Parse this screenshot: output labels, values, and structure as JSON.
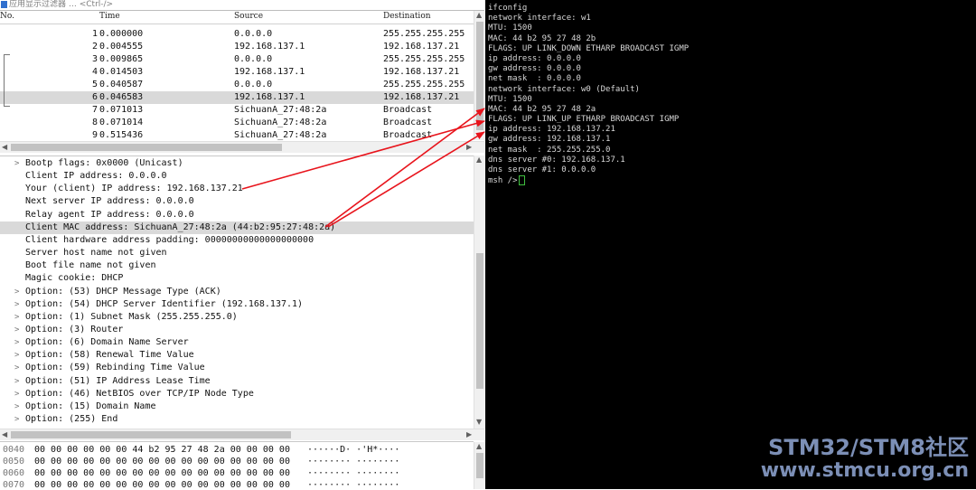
{
  "filter_bar": {
    "placeholder": "应用显示过滤器 … <Ctrl-/>"
  },
  "packet_list": {
    "columns": [
      "No.",
      "Time",
      "Source",
      "Destination"
    ],
    "rows": [
      {
        "no": "1",
        "time": "0.000000",
        "source": "0.0.0.0",
        "destination": "255.255.255.255"
      },
      {
        "no": "2",
        "time": "0.004555",
        "source": "192.168.137.1",
        "destination": "192.168.137.21"
      },
      {
        "no": "3",
        "time": "0.009865",
        "source": "0.0.0.0",
        "destination": "255.255.255.255"
      },
      {
        "no": "4",
        "time": "0.014503",
        "source": "192.168.137.1",
        "destination": "192.168.137.21"
      },
      {
        "no": "5",
        "time": "0.040587",
        "source": "0.0.0.0",
        "destination": "255.255.255.255"
      },
      {
        "no": "6",
        "time": "0.046583",
        "source": "192.168.137.1",
        "destination": "192.168.137.21",
        "selected": true
      },
      {
        "no": "7",
        "time": "0.071013",
        "source": "SichuanA_27:48:2a",
        "destination": "Broadcast"
      },
      {
        "no": "8",
        "time": "0.071014",
        "source": "SichuanA_27:48:2a",
        "destination": "Broadcast"
      },
      {
        "no": "9",
        "time": "0.515436",
        "source": "SichuanA_27:48:2a",
        "destination": "Broadcast"
      }
    ]
  },
  "details": [
    {
      "text": "Bootp flags: 0x0000 (Unicast)",
      "expandable": true
    },
    {
      "text": "Client IP address: 0.0.0.0"
    },
    {
      "text": "Your (client) IP address: 192.168.137.21"
    },
    {
      "text": "Next server IP address: 0.0.0.0"
    },
    {
      "text": "Relay agent IP address: 0.0.0.0"
    },
    {
      "text": "Client MAC address: SichuanA_27:48:2a (44:b2:95:27:48:2a)",
      "selected": true
    },
    {
      "text": "Client hardware address padding: 00000000000000000000"
    },
    {
      "text": "Server host name not given"
    },
    {
      "text": "Boot file name not given"
    },
    {
      "text": "Magic cookie: DHCP"
    },
    {
      "text": "Option: (53) DHCP Message Type (ACK)",
      "expandable": true
    },
    {
      "text": "Option: (54) DHCP Server Identifier (192.168.137.1)",
      "expandable": true
    },
    {
      "text": "Option: (1) Subnet Mask (255.255.255.0)",
      "expandable": true
    },
    {
      "text": "Option: (3) Router",
      "expandable": true
    },
    {
      "text": "Option: (6) Domain Name Server",
      "expandable": true
    },
    {
      "text": "Option: (58) Renewal Time Value",
      "expandable": true
    },
    {
      "text": "Option: (59) Rebinding Time Value",
      "expandable": true
    },
    {
      "text": "Option: (51) IP Address Lease Time",
      "expandable": true
    },
    {
      "text": "Option: (46) NetBIOS over TCP/IP Node Type",
      "expandable": true
    },
    {
      "text": "Option: (15) Domain Name",
      "expandable": true
    },
    {
      "text": "Option: (255) End",
      "expandable": true
    }
  ],
  "bytes": [
    {
      "offset": "0040",
      "hex": "00 00 00 00 00 00 44 b2  95 27 48 2a 00 00 00 00",
      "ascii": "······D· ·'H*····"
    },
    {
      "offset": "0050",
      "hex": "00 00 00 00 00 00 00 00  00 00 00 00 00 00 00 00",
      "ascii": "········ ········"
    },
    {
      "offset": "0060",
      "hex": "00 00 00 00 00 00 00 00  00 00 00 00 00 00 00 00",
      "ascii": "········ ········"
    },
    {
      "offset": "0070",
      "hex": "00 00 00 00 00 00 00 00  00 00 00 00 00 00 00 00",
      "ascii": "········ ········"
    }
  ],
  "terminal": {
    "lines": [
      "ifconfig",
      "network interface: w1",
      "MTU: 1500",
      "MAC: 44 b2 95 27 48 2b",
      "FLAGS: UP LINK_DOWN ETHARP BROADCAST IGMP",
      "ip address: 0.0.0.0",
      "gw address: 0.0.0.0",
      "net mask  : 0.0.0.0",
      "network interface: w0 (Default)",
      "MTU: 1500",
      "MAC: 44 b2 95 27 48 2a",
      "FLAGS: UP LINK_UP ETHARP BROADCAST IGMP",
      "ip address: 192.168.137.21",
      "gw address: 192.168.137.1",
      "net mask  : 255.255.255.0",
      "dns server #0: 192.168.137.1",
      "dns server #1: 0.0.0.0"
    ],
    "prompt": "msh />"
  },
  "watermark": {
    "line1": "STM32/STM8社区",
    "line2": "www.stmcu.org.cn"
  },
  "colors": {
    "annotation_arrow": "#e8141c",
    "terminal_bg": "#000000",
    "terminal_fg": "#d8d8d8",
    "selection": "#d9d9d9",
    "watermark": "#7c8fb6"
  }
}
